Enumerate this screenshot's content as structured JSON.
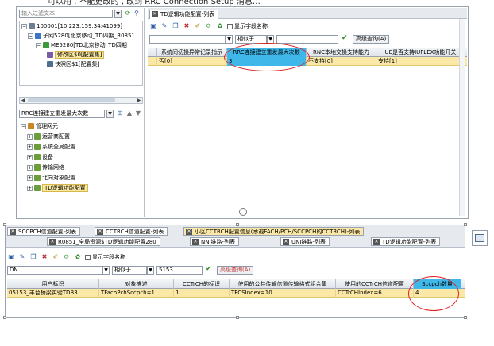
{
  "caption": "可以用 ,  不能更改的 , 改到 RRC Connection Setup 消息…",
  "left_panel": {
    "filter_placeholder": "输入过滤文本",
    "tree_top": [
      {
        "label": "100001[10.223.159.34:41099]",
        "level": 0
      },
      {
        "label": "子网5280[北京移动_TD四期_R0851",
        "level": 1
      },
      {
        "label": "ME5280[TD北京移动_TD四期_",
        "level": 2
      },
      {
        "label": "修改区$0[配置集]",
        "level": 3,
        "selected": true
      },
      {
        "label": "快照区$1[配置集]",
        "level": 3
      }
    ],
    "combo_value": "RRC连接建立重发最大次数",
    "tree_bottom": [
      {
        "label": "管理网元",
        "level": 0
      },
      {
        "label": "运营商配置",
        "level": 1
      },
      {
        "label": "系统全局配置",
        "level": 1
      },
      {
        "label": "设备",
        "level": 1
      },
      {
        "label": "传输网络",
        "level": 1
      },
      {
        "label": "北向对象配置",
        "level": 1
      },
      {
        "label": "TD逻辑功能配置",
        "level": 1,
        "selected": true
      }
    ]
  },
  "right_panel": {
    "tab_label": "TD逻辑功能配置-列表",
    "show_field_name": "显示字段名称",
    "op_value": "相似于",
    "query_button": "高级查询(A)",
    "columns": [
      "系统间切换异常记录指示",
      "RRC连接建立重发最大次数",
      "RNC本地交换支持能力",
      "UE是否支持IUFLEX功能开关"
    ],
    "row": [
      "否[0]",
      "3",
      "不支持[0]",
      "支持[1]"
    ]
  },
  "bottom_window": {
    "tabs_row1": [
      "SCCPCH信道配置-列表",
      "CCTRCH信道配置-列表",
      "小区CCTRCH配置信息(承载FACH/PCH/SCCPCH的CCTRCH)-列表"
    ],
    "tabs_row2": [
      "R0851_全局资源$TD逻辑功能配置280",
      "NNI链路-列表",
      "UNI链路-列表",
      "TD逻辑功能配置-列表"
    ],
    "show_field_name": "显示字段名称",
    "field_value": "DN",
    "op_value": "相似于",
    "query_value": "5153",
    "query_button": "高级查询(A)",
    "columns": [
      "用户标识",
      "对象描述",
      "CCTrCH的标识",
      "使用的公共传输信道传输格式组合集",
      "使用的CCTrCH信道配置",
      "Sccpch数量"
    ],
    "row": [
      "05153_丰台桥梁实验TDB3",
      "TFachPchSccpch=1",
      "1",
      "TFCSIndex=10",
      "CCTrCHIndex=6",
      "4"
    ]
  }
}
